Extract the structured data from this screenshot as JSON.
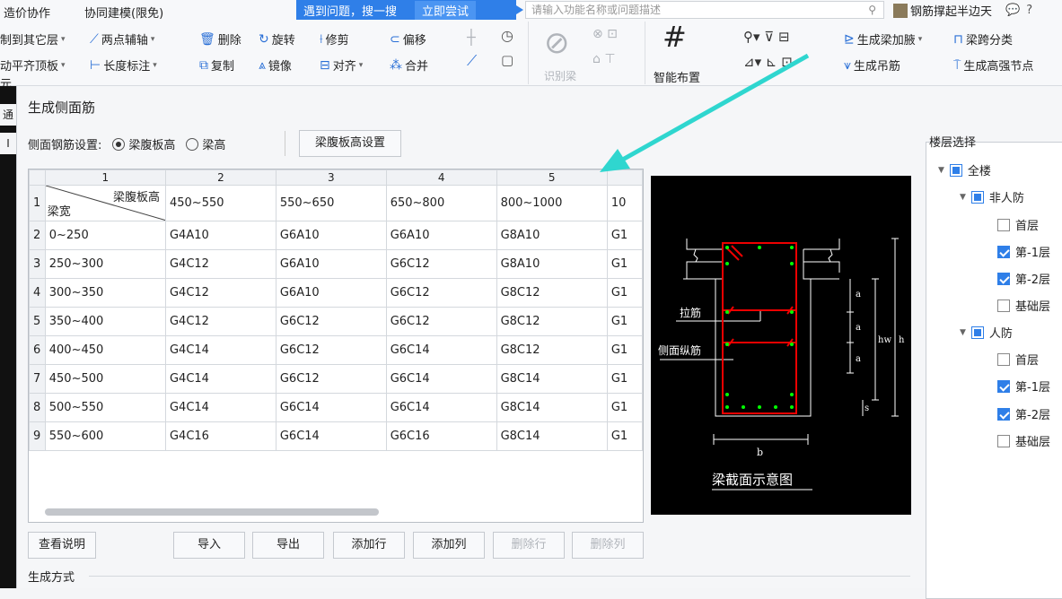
{
  "menu": {
    "item1": "造价协作",
    "item2": "协同建模(限免)"
  },
  "helpbar": {
    "text": "遇到问题，搜一搜",
    "try": "立即尝试"
  },
  "search": {
    "placeholder": "请输入功能名称或问题描述"
  },
  "user": {
    "name": "钢筋撑起半边天"
  },
  "ribbon": {
    "copy_to_floor": "制到其它层",
    "auto_flat_top": "动平齐顶板",
    "elem": "元",
    "comm": "通",
    "two_point_axis": "两点辅轴",
    "length_mark": "长度标注",
    "delete": "删除",
    "rotate": "旋转",
    "trim": "修剪",
    "offset": "偏移",
    "copy": "复制",
    "mirror": "镜像",
    "align": "对齐",
    "merge": "合并",
    "recognize_beam": "识别梁",
    "smart_layout": "智能布置",
    "gen_beam_haunch": "生成梁加腋",
    "beam_span_class": "梁跨分类",
    "gen_hanger": "生成吊筋",
    "gen_strong_node": "生成高强节点"
  },
  "left_strip": {
    "a": "通",
    "b": "I"
  },
  "dialog": {
    "title": "生成侧面筋",
    "setting_label": "侧面钢筋设置:",
    "opt_web_height": "梁腹板高",
    "opt_height": "梁高",
    "web_height_setting": "梁腹板高设置",
    "gen_mode": "生成方式"
  },
  "table": {
    "col_headers": [
      "1",
      "2",
      "3",
      "4",
      "5",
      ""
    ],
    "header_row": {
      "corner_top": "梁腹板高",
      "corner_bottom": "梁宽",
      "cells": [
        "450~550",
        "550~650",
        "650~800",
        "800~1000",
        "10"
      ]
    },
    "rows": [
      {
        "n": "2",
        "w": "0~250",
        "c": [
          "G4A10",
          "G6A10",
          "G6A10",
          "G8A10",
          "G1"
        ]
      },
      {
        "n": "3",
        "w": "250~300",
        "c": [
          "G4C12",
          "G6A10",
          "G6C12",
          "G8A10",
          "G1"
        ]
      },
      {
        "n": "4",
        "w": "300~350",
        "c": [
          "G4C12",
          "G6A10",
          "G6C12",
          "G8C12",
          "G1"
        ]
      },
      {
        "n": "5",
        "w": "350~400",
        "c": [
          "G4C12",
          "G6C12",
          "G6C12",
          "G8C12",
          "G1"
        ]
      },
      {
        "n": "6",
        "w": "400~450",
        "c": [
          "G4C14",
          "G6C12",
          "G6C14",
          "G8C12",
          "G1"
        ]
      },
      {
        "n": "7",
        "w": "450~500",
        "c": [
          "G4C14",
          "G6C12",
          "G6C14",
          "G8C14",
          "G1"
        ]
      },
      {
        "n": "8",
        "w": "500~550",
        "c": [
          "G4C14",
          "G6C14",
          "G6C14",
          "G8C14",
          "G1"
        ]
      },
      {
        "n": "9",
        "w": "550~600",
        "c": [
          "G4C16",
          "G6C14",
          "G6C16",
          "G8C14",
          "G1"
        ]
      }
    ],
    "row1_n": "1"
  },
  "diagram": {
    "tie_bar": "拉筋",
    "side_long_bar": "侧面纵筋",
    "caption": "梁截面示意图",
    "a": "a",
    "hw": "hw",
    "h": "h",
    "s": "s",
    "b": "b"
  },
  "buttons": {
    "view_desc": "查看说明",
    "import": "导入",
    "export": "导出",
    "add_row": "添加行",
    "add_col": "添加列",
    "del_row": "删除行",
    "del_col": "删除列"
  },
  "floors": {
    "title": "楼层选择",
    "all": "全楼",
    "non_civil": "非人防",
    "civil": "人防",
    "first": "首层",
    "neg1": "第-1层",
    "neg2": "第-2层",
    "base": "基础层"
  }
}
